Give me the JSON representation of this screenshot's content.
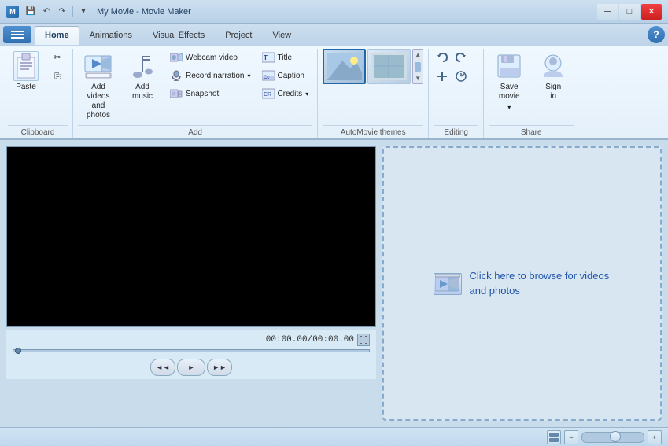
{
  "window": {
    "title": "My Movie - Movie Maker",
    "icon": "M"
  },
  "titlebar": {
    "minimize": "─",
    "maximize": "□",
    "close": "✕"
  },
  "qat": {
    "save": "💾",
    "undo": "↶",
    "redo": "↷"
  },
  "ribbon": {
    "tabs": [
      "Home",
      "Animations",
      "Visual Effects",
      "Project",
      "View"
    ],
    "active_tab": "Home",
    "help": "?"
  },
  "groups": {
    "clipboard": {
      "label": "Clipboard",
      "paste": "Paste",
      "cut": "✂",
      "copy": "⎘"
    },
    "add": {
      "label": "Add",
      "add_videos": "Add videos\nand photos",
      "add_music": "Add\nmusic",
      "webcam_video": "Webcam video",
      "record_narration": "Record narration",
      "snapshot": "Snapshot",
      "title": "Title",
      "caption": "Caption",
      "credits": "Credits"
    },
    "automovie": {
      "label": "AutoMovie themes"
    },
    "editing": {
      "label": "Editing"
    },
    "share": {
      "label": "Share",
      "save_movie": "Save\nmovie",
      "sign_in": "Sign\nin"
    }
  },
  "video": {
    "time_display": "00:00.00/00:00.00",
    "prev_frame": "◄◄",
    "play": "►",
    "next_frame": "►►"
  },
  "browse": {
    "text": "Click here to browse for videos and photos"
  },
  "status": {
    "zoom_minus": "−",
    "zoom_plus": "+"
  }
}
